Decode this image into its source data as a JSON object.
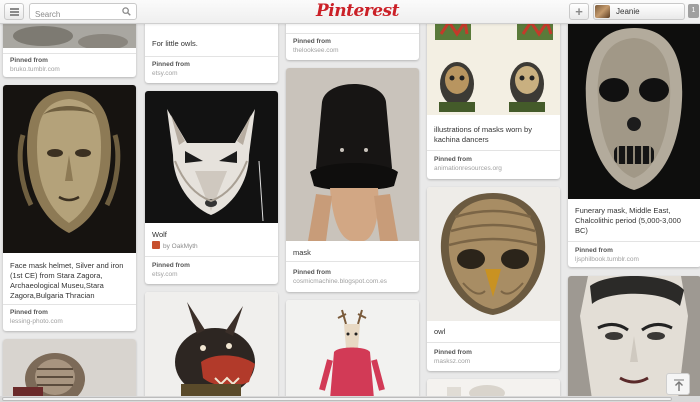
{
  "header": {
    "search_placeholder": "Search",
    "logo_text": "Pinterest",
    "add_label": "+",
    "user_name": "Jeanie",
    "notification_count": "1"
  },
  "pins": [
    {
      "pinned_label": "Pinned from",
      "source": "bruko.tumblr.com"
    },
    {
      "description": "Face mask helmet, Silver and iron (1st CE) from Stara Zagora, Archaeological Museu,Stara Zagora,Bulgaria Thracian",
      "pinned_label": "Pinned from",
      "source": "lessing-photo.com"
    },
    {
      "description": "For little owls.",
      "pinned_label": "Pinned from",
      "source": "etsy.com"
    },
    {
      "description": "Wolf",
      "via": "by OakMyth",
      "pinned_label": "Pinned from",
      "source": "etsy.com"
    },
    {
      "pinned_label": "Pinned from",
      "source": "thelooksee.com"
    },
    {
      "description": "mask",
      "pinned_label": "Pinned from",
      "source": "cosmicmachine.blogspot.com.es"
    },
    {
      "description": "illustrations of masks worn by kachina dancers",
      "pinned_label": "Pinned from",
      "source": "animationresources.org"
    },
    {
      "description": "owl",
      "pinned_label": "Pinned from",
      "source": "masksz.com"
    },
    {
      "description": "Funerary mask, Middle East, Chalcolithic period (5,000-3,000 BC)",
      "pinned_label": "Pinned from",
      "source": "ljsphilbook.tumblr.com"
    }
  ],
  "colors": {
    "brand": "#cb2027",
    "background": "#e9e9e9"
  },
  "icons": {
    "menu": "menu-icon",
    "search": "search-icon",
    "add": "plus-icon",
    "scroll_top": "arrow-up-icon"
  }
}
